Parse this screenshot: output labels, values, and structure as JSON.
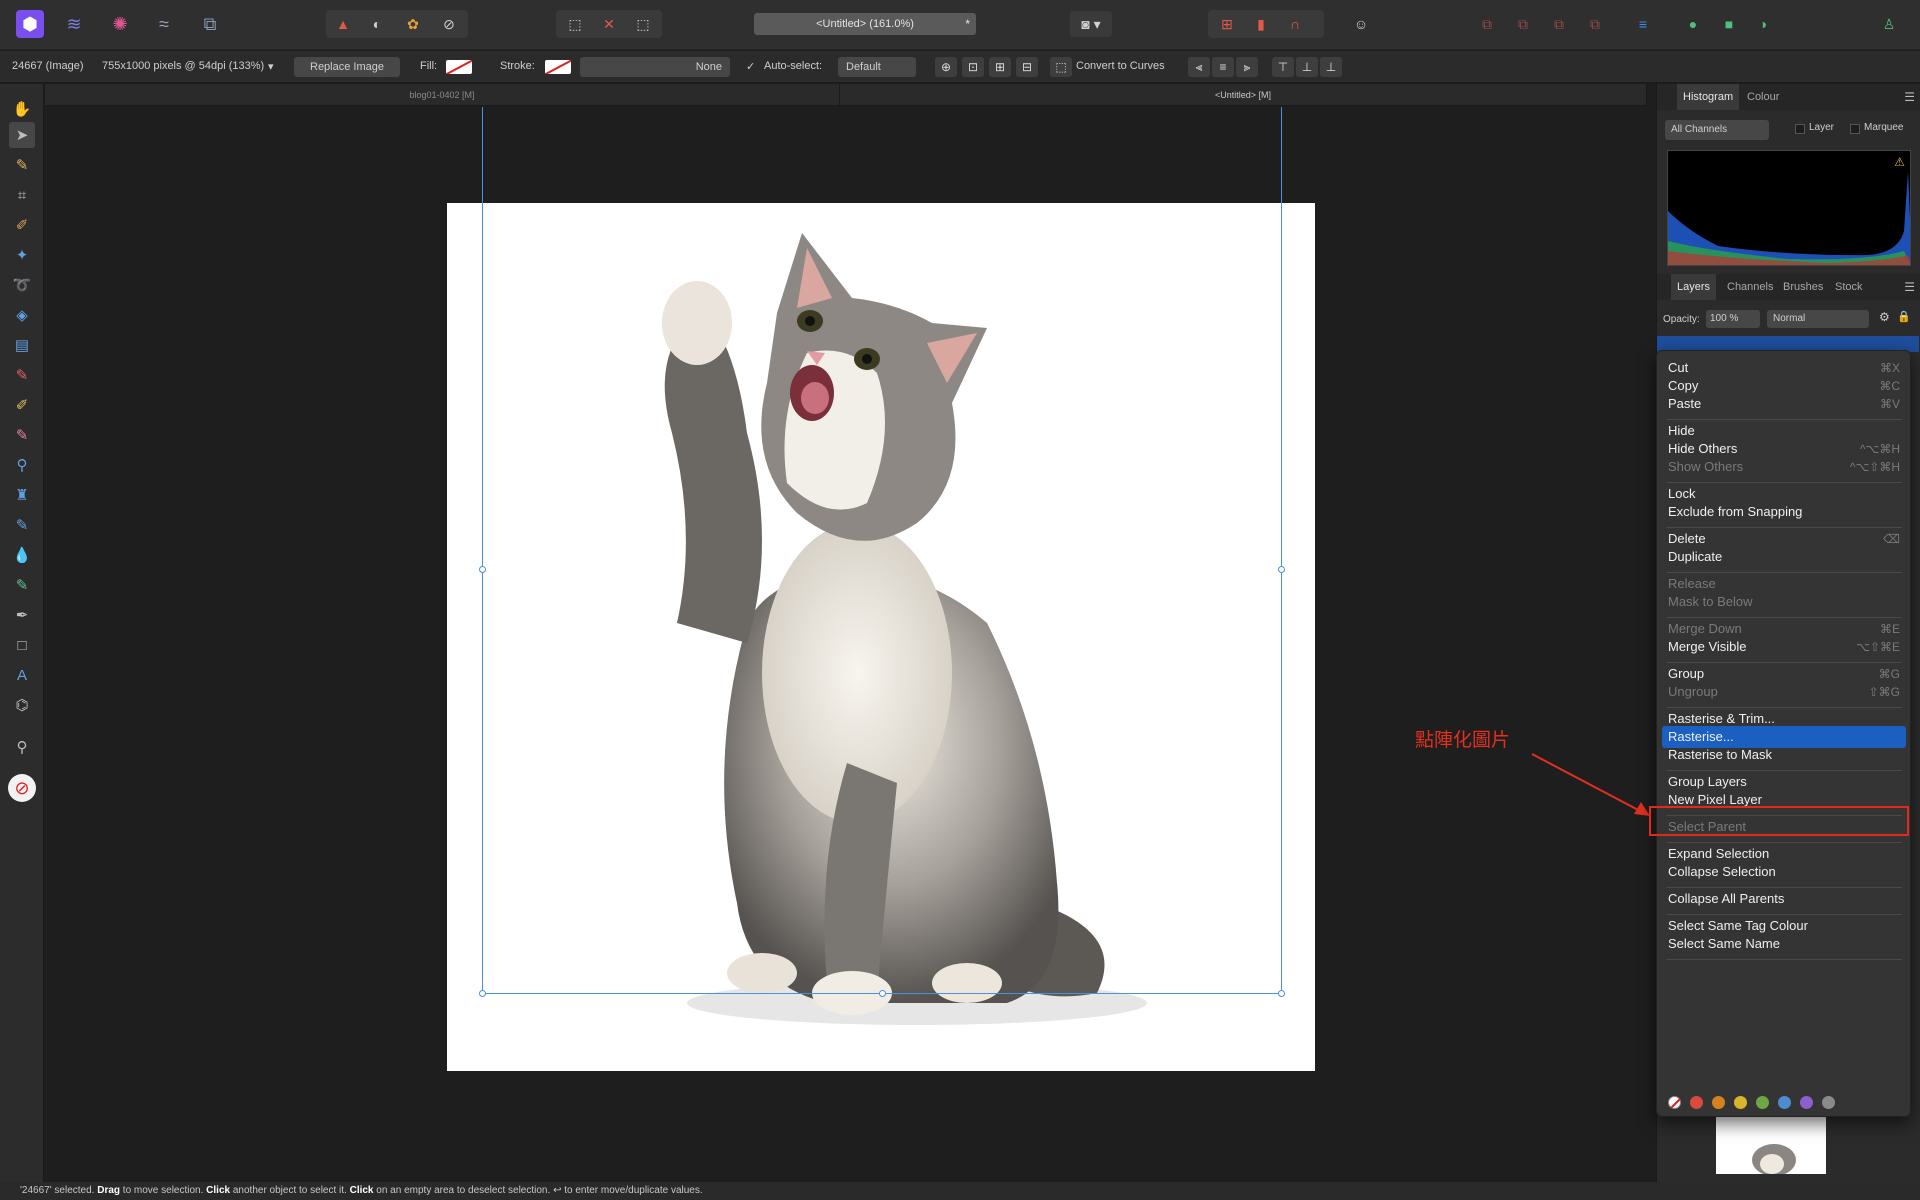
{
  "topbar": {
    "doc_title": "<Untitled> (161.0%)",
    "doc_modified": "*"
  },
  "context_toolbar": {
    "object_name": "24667 (Image)",
    "dimensions": "755x1000 pixels @ 54dpi (133%)",
    "replace_image": "Replace Image",
    "fill_label": "Fill:",
    "stroke_label": "Stroke:",
    "stroke_value": "None",
    "auto_select_label": "Auto-select:",
    "auto_select_value": "Default",
    "convert_label": "Convert to Curves"
  },
  "doc_tabs": [
    {
      "label": "blog01-0402 [M]"
    },
    {
      "label": "<Untitled> [M]"
    }
  ],
  "canvas": {
    "annotation": "點陣化圖片",
    "image_desc": "cat"
  },
  "panels": {
    "top_tabs": [
      "Histogram",
      "Colour"
    ],
    "channels_value": "All Channels",
    "layer_checkbox": "Layer",
    "marquee_checkbox": "Marquee",
    "bottom_tabs": [
      "Layers",
      "Channels",
      "Brushes",
      "Stock"
    ],
    "opacity_label": "Opacity:",
    "opacity_value": "100 %",
    "blend_mode": "Normal"
  },
  "context_menu": {
    "items": [
      {
        "label": "Cut",
        "shortcut": "⌘X"
      },
      {
        "label": "Copy",
        "shortcut": "⌘C"
      },
      {
        "label": "Paste",
        "shortcut": "⌘V"
      },
      {
        "label": "Hide",
        "shortcut": ""
      },
      {
        "label": "Hide Others",
        "shortcut": "^⌥⌘H"
      },
      {
        "label": "Show Others",
        "shortcut": "^⌥⇧⌘H"
      },
      {
        "label": "Lock",
        "shortcut": ""
      },
      {
        "label": "Exclude from Snapping",
        "shortcut": ""
      },
      {
        "label": "Delete",
        "shortcut": "⌫"
      },
      {
        "label": "Duplicate",
        "shortcut": ""
      },
      {
        "label": "Release",
        "shortcut": ""
      },
      {
        "label": "Mask to Below",
        "shortcut": ""
      },
      {
        "label": "Merge Down",
        "shortcut": "⌘E"
      },
      {
        "label": "Merge Visible",
        "shortcut": "⌥⇧⌘E"
      },
      {
        "label": "Group",
        "shortcut": "⌘G"
      },
      {
        "label": "Ungroup",
        "shortcut": "⇧⌘G"
      },
      {
        "label": "Rasterise & Trim...",
        "shortcut": ""
      },
      {
        "label": "Rasterise...",
        "shortcut": ""
      },
      {
        "label": "Rasterise to Mask",
        "shortcut": ""
      },
      {
        "label": "Group Layers",
        "shortcut": ""
      },
      {
        "label": "New Pixel Layer",
        "shortcut": ""
      },
      {
        "label": "Select Parent",
        "shortcut": ""
      },
      {
        "label": "Expand Selection",
        "shortcut": ""
      },
      {
        "label": "Collapse Selection",
        "shortcut": ""
      },
      {
        "label": "Collapse All Parents",
        "shortcut": ""
      },
      {
        "label": "Select Same Tag Colour",
        "shortcut": ""
      },
      {
        "label": "Select Same Name",
        "shortcut": ""
      }
    ],
    "tag_colors": [
      "#d94a3d",
      "#d4811f",
      "#d8b52a",
      "#6ea743",
      "#4d8ccf",
      "#8c5fcf",
      "#8a8a8a"
    ]
  },
  "statusbar": {
    "p1": "'24667' selected. ",
    "b1": "Drag",
    "p2": " to move selection. ",
    "b2": "Click",
    "p3": " another object to select it. ",
    "b3": "Click",
    "p4": " on an empty area to deselect selection. ",
    "p5": "↩ to enter move/duplicate values."
  }
}
